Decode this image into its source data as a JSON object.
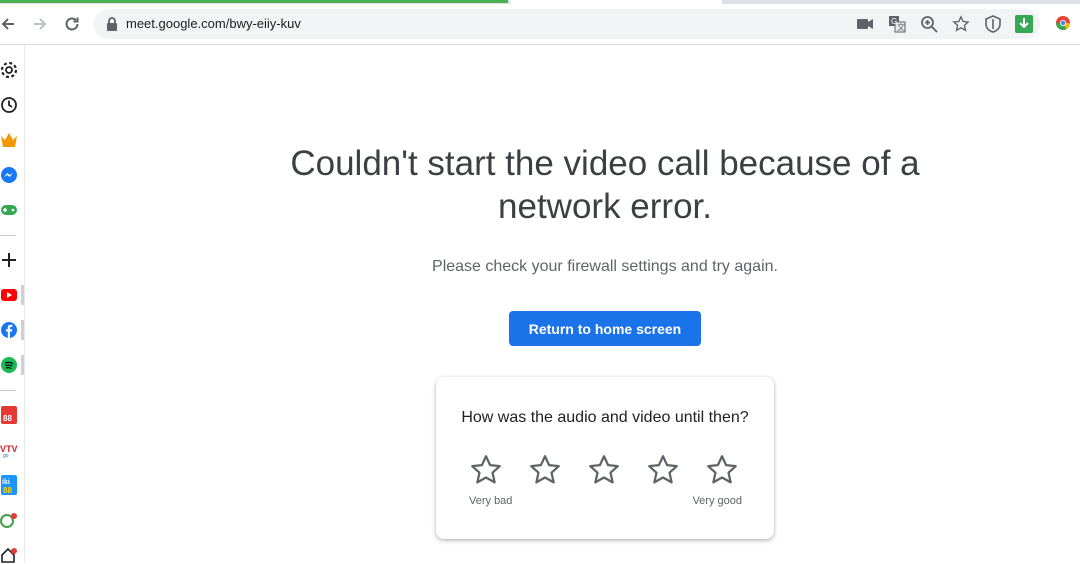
{
  "browser": {
    "url": "meet.google.com/bwy-eiiy-kuv",
    "icons": [
      "back-icon",
      "forward-icon",
      "reload-icon",
      "lock-icon",
      "camera-icon",
      "translate-icon",
      "zoom-icon",
      "bookmark-star-icon",
      "shield-icon",
      "download-icon",
      "chrome-extension-icon"
    ]
  },
  "sidebar": {
    "items": [
      "settings-icon",
      "history-icon",
      "crown-icon",
      "messenger-icon",
      "gamepad-icon",
      "add-icon",
      "youtube-icon",
      "facebook-icon",
      "spotify-icon",
      "app-88-icon",
      "vtv-icon",
      "tiki-icon",
      "app-icon",
      "home-icon"
    ]
  },
  "main": {
    "headline": "Couldn't start the video call because of a network error.",
    "subtext": "Please check your firewall settings and try again.",
    "return_button": "Return to home screen"
  },
  "feedback": {
    "question": "How was the audio and video until then?",
    "rating_max": 5,
    "rating_selected": 0,
    "low_label": "Very bad",
    "high_label": "Very good"
  },
  "colors": {
    "accent": "#1a73e8",
    "text_primary": "#3c4043",
    "text_secondary": "#5f6368"
  }
}
